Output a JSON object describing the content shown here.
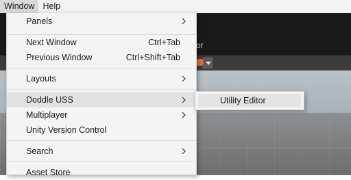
{
  "menubar": {
    "items": [
      {
        "label": "Window"
      },
      {
        "label": "Help"
      }
    ]
  },
  "editor": {
    "partial_label": "or"
  },
  "window_menu": {
    "items": [
      {
        "label": "Panels",
        "shortcut": "",
        "submenu": true
      },
      {
        "label": "Next Window",
        "shortcut": "Ctrl+Tab",
        "submenu": false
      },
      {
        "label": "Previous Window",
        "shortcut": "Ctrl+Shift+Tab",
        "submenu": false
      },
      {
        "label": "Layouts",
        "shortcut": "",
        "submenu": true
      },
      {
        "label": "Doddle USS",
        "shortcut": "",
        "submenu": true
      },
      {
        "label": "Multiplayer",
        "shortcut": "",
        "submenu": true
      },
      {
        "label": "Unity Version Control",
        "shortcut": "",
        "submenu": false
      },
      {
        "label": "Search",
        "shortcut": "",
        "submenu": true
      },
      {
        "label": "Asset Store",
        "shortcut": "",
        "submenu": false
      }
    ]
  },
  "submenu": {
    "items": [
      {
        "label": "Utility Editor"
      }
    ]
  },
  "icons": {
    "submenu_arrow": "chevron-right-icon",
    "dropdown": "chevron-down-icon"
  },
  "colors": {
    "menu_bg": "#f4f4f4",
    "highlight": "#e2e2e2",
    "editor_dark": "#191919"
  }
}
